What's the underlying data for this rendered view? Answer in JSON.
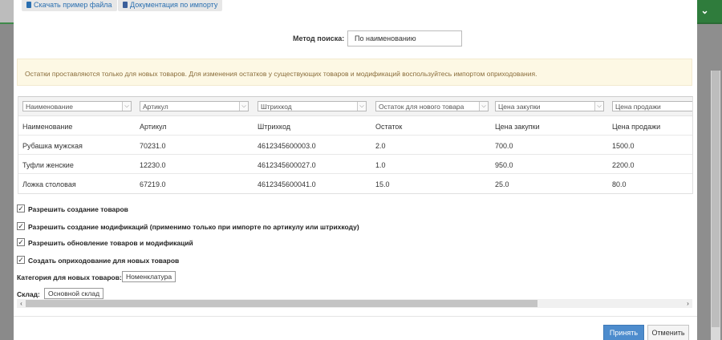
{
  "top_buttons": {
    "download_sample": "Скачать пример файла",
    "import_docs": "Документация по импорту"
  },
  "search_method": {
    "label": "Метод поиска:",
    "value": "По наименованию"
  },
  "notice": "Остатки проставляются только для новых товаров. Для изменения остатков у существующих товаров и модификаций воспользуйтесь импортом оприходования.",
  "column_mapping": [
    "Наименование",
    "Артикул",
    "Штрихкод",
    "Остаток для нового товара",
    "Цена закупки",
    "Цена продажи"
  ],
  "table": {
    "headers": [
      "Наименование",
      "Артикул",
      "Штрихкод",
      "Остаток",
      "Цена закупки",
      "Цена продажи"
    ],
    "rows": [
      [
        "Рубашка мужская",
        "70231.0",
        "4612345600003.0",
        "2.0",
        "700.0",
        "1500.0"
      ],
      [
        "Туфли женские",
        "12230.0",
        "4612345600027.0",
        "1.0",
        "950.0",
        "2200.0"
      ],
      [
        "Ложка столовая",
        "67219.0",
        "4612345600041.0",
        "15.0",
        "25.0",
        "80.0"
      ]
    ]
  },
  "options": [
    {
      "label": "Разрешить создание товаров",
      "checked": true
    },
    {
      "label": "Разрешить создание модификаций (применимо только при импорте по артикулу или штрихкоду)",
      "checked": true
    },
    {
      "label": "Разрешить обновление товаров и модификаций",
      "checked": true
    },
    {
      "label": "Создать оприходование для новых товаров",
      "checked": true
    }
  ],
  "category": {
    "label": "Категория для новых товаров:",
    "value": "Номенклатура"
  },
  "warehouse": {
    "label": "Склад:",
    "value": "Основной склад"
  },
  "footer": {
    "accept": "Принять",
    "cancel": "Отменить"
  },
  "colors": {
    "accent": "#4d8ccd",
    "notice_bg": "#fdf8e4",
    "brand_green": "#2f7c3c"
  }
}
